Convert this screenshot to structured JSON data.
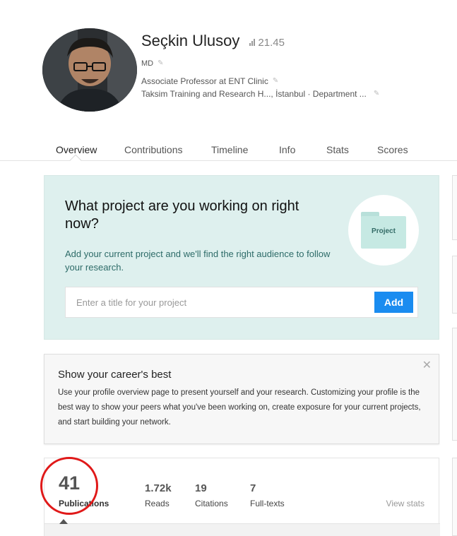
{
  "profile": {
    "name": "Seçkin Ulusoy",
    "score": "21.45",
    "degree": "MD",
    "position": "Associate Professor at ENT Clinic",
    "institution": "Taksim Training and Research H..., İstanbul · Department ..."
  },
  "tabs": [
    {
      "label": "Overview",
      "active": true
    },
    {
      "label": "Contributions"
    },
    {
      "label": "Timeline"
    },
    {
      "label": "Info"
    },
    {
      "label": "Stats"
    },
    {
      "label": "Scores"
    }
  ],
  "project": {
    "title": "What project are you working on right now?",
    "subtitle": "Add your current project and we'll find the right audience to follow your research.",
    "folder_label": "Project",
    "input_placeholder": "Enter a title for your project",
    "add_label": "Add"
  },
  "career": {
    "title": "Show your career's best",
    "text": "Use your profile overview page to present yourself and your research. Customizing your profile is the best way to show your peers what you've been working on, create exposure for your current projects, and start building your network.",
    "close": "✕"
  },
  "stats": {
    "publications": {
      "value": "41",
      "label": "Publications"
    },
    "reads": {
      "value": "1.72k",
      "label": "Reads"
    },
    "citations": {
      "value": "19",
      "label": "Citations"
    },
    "fulltexts": {
      "value": "7",
      "label": "Full-texts"
    },
    "view_stats": "View stats"
  },
  "colors": {
    "accent": "#1a8cf0",
    "project_bg": "#def0ee",
    "highlight_circle": "#e01919"
  },
  "icons": {
    "edit": "pencil-icon",
    "score": "bar-chart-icon",
    "close": "close-icon",
    "folder": "folder-icon"
  }
}
